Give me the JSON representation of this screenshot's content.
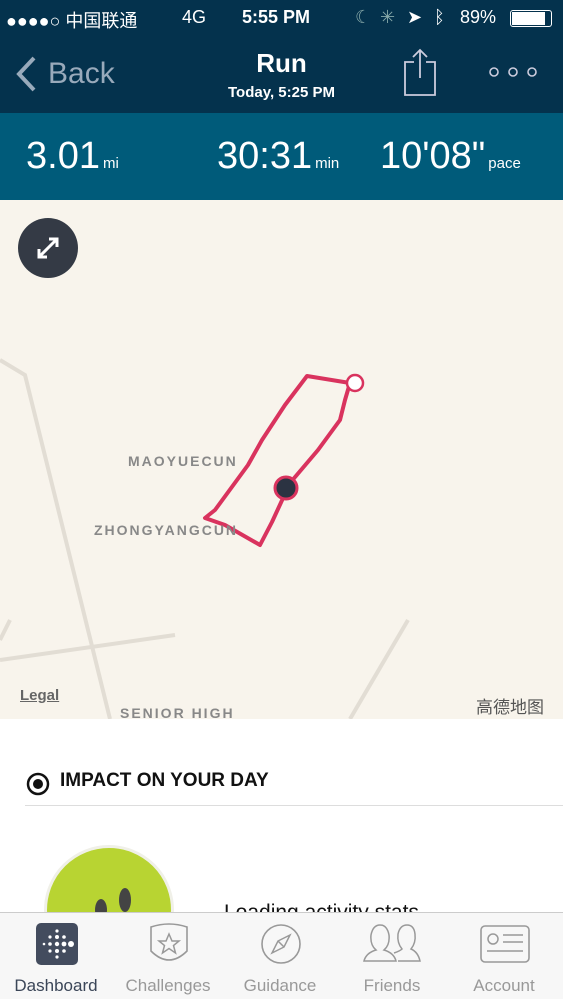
{
  "status_bar": {
    "carrier": "●●●●○ 中国联通",
    "network": "4G",
    "time": "5:55 PM",
    "battery": "89%"
  },
  "nav": {
    "back_label": "Back",
    "title": "Run",
    "subtitle": "Today, 5:25 PM"
  },
  "stats": [
    {
      "value": "3.01",
      "unit": "mi"
    },
    {
      "value": "30:31",
      "unit": "min"
    },
    {
      "value": "10'08\"",
      "unit": "pace"
    }
  ],
  "map": {
    "labels": [
      "MAOYUECUN",
      "ZHONGYANGCUN",
      "SENIOR HIGH"
    ],
    "legal": "Legal",
    "provider": "高德地图",
    "route_color": "#d9335e"
  },
  "impact": {
    "title": "IMPACT ON YOUR DAY",
    "loading": "Loading activity stats"
  },
  "tabs": [
    {
      "label": "Dashboard",
      "active": true
    },
    {
      "label": "Challenges"
    },
    {
      "label": "Guidance"
    },
    {
      "label": "Friends"
    },
    {
      "label": "Account"
    }
  ]
}
